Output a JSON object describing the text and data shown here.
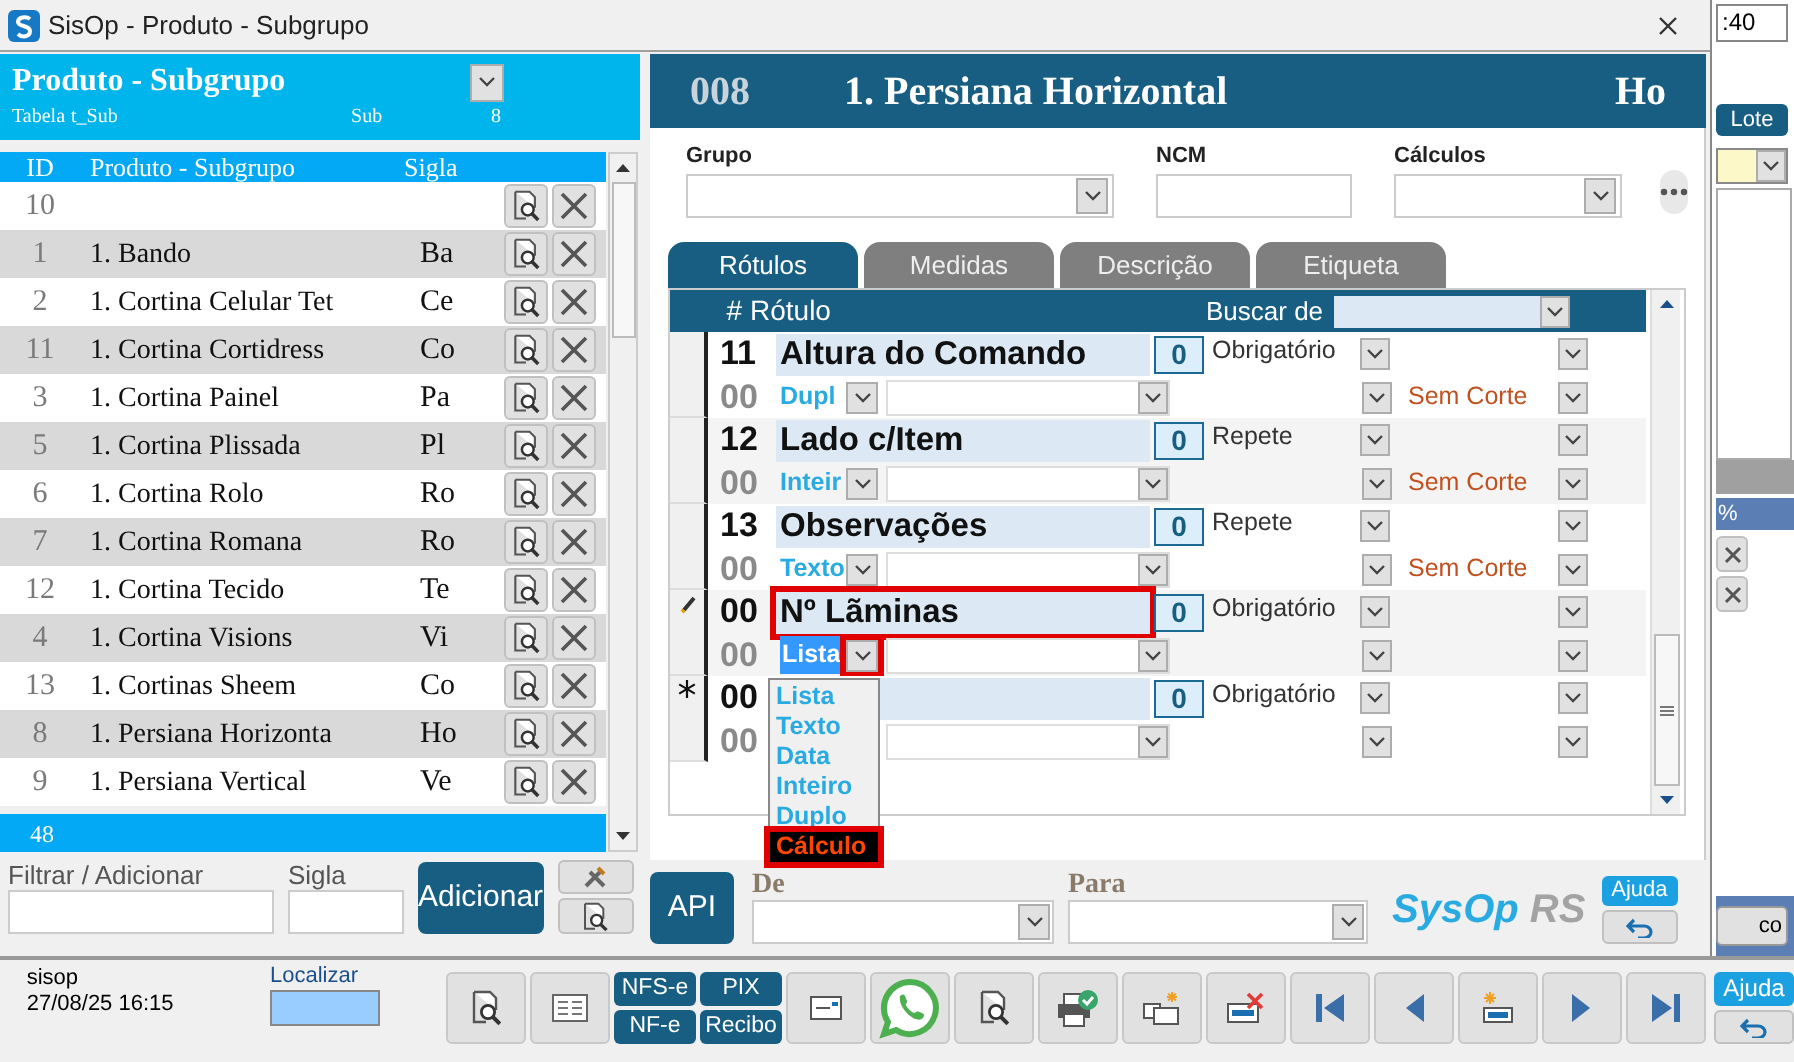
{
  "window": {
    "title": "SisOp - Produto - Subgrupo"
  },
  "list_panel": {
    "title": "Produto - Subgrupo",
    "table_label": "Tabela",
    "table_name": "t_Sub",
    "prefix": "Sub",
    "code": "8",
    "columns": [
      "ID",
      "Produto - Subgrupo",
      "Sigla"
    ],
    "rows": [
      {
        "id": "10",
        "name": "",
        "sigla": ""
      },
      {
        "id": "1",
        "name": "1. Bando",
        "sigla": "Ba"
      },
      {
        "id": "2",
        "name": "1. Cortina Celular Tet",
        "sigla": "Ce"
      },
      {
        "id": "11",
        "name": "1. Cortina Cortidress",
        "sigla": "Co"
      },
      {
        "id": "3",
        "name": "1. Cortina Painel",
        "sigla": "Pa"
      },
      {
        "id": "5",
        "name": "1. Cortina Plissada",
        "sigla": "Pl"
      },
      {
        "id": "6",
        "name": "1. Cortina Rolo",
        "sigla": "Ro"
      },
      {
        "id": "7",
        "name": "1. Cortina Romana",
        "sigla": "Ro"
      },
      {
        "id": "12",
        "name": "1. Cortina Tecido",
        "sigla": "Te"
      },
      {
        "id": "4",
        "name": "1. Cortina Visions",
        "sigla": "Vi"
      },
      {
        "id": "13",
        "name": "1. Cortinas Sheem",
        "sigla": "Co"
      },
      {
        "id": "8",
        "name": "1. Persiana Horizonta",
        "sigla": "Ho"
      },
      {
        "id": "9",
        "name": "1. Persiana Vertical",
        "sigla": "Ve"
      }
    ],
    "count": "48"
  },
  "filter": {
    "label": "Filtrar / Adicionar",
    "sigla_label": "Sigla",
    "add_button": "Adicionar"
  },
  "detail": {
    "code": "008",
    "title": "1. Persiana Horizontal",
    "sigla": "Ho",
    "fields": [
      {
        "label": "Grupo",
        "kind": "select"
      },
      {
        "label": "NCM",
        "kind": "text"
      },
      {
        "label": "Cálculos",
        "kind": "select"
      }
    ],
    "tabs": [
      {
        "label": "Rótulos",
        "selected": true
      },
      {
        "label": "Medidas",
        "selected": false
      },
      {
        "label": "Descrição",
        "selected": false
      },
      {
        "label": "Etiqueta",
        "selected": false
      }
    ],
    "grid": {
      "columns": [
        "#",
        "Rótulo"
      ],
      "search_label": "Buscar de",
      "records": [
        {
          "kind": "record",
          "number": "11",
          "label": "Altura do Comando",
          "count": "0",
          "rule": "Obrigatório",
          "sub_number": "00",
          "type": "Dupl",
          "cut": "Sem Corte",
          "label_highlighted": false,
          "type_selected": false,
          "type_dropdown_highlighted": false
        },
        {
          "kind": "record",
          "number": "12",
          "label": "Lado c/Item",
          "count": "0",
          "rule": "Repete",
          "sub_number": "00",
          "type": "Inteir",
          "cut": "Sem Corte",
          "label_highlighted": false,
          "type_selected": false,
          "type_dropdown_highlighted": false
        },
        {
          "kind": "record",
          "number": "13",
          "label": "Observações",
          "count": "0",
          "rule": "Repete",
          "sub_number": "00",
          "type": "Texto",
          "cut": "Sem Corte",
          "label_highlighted": false,
          "type_selected": false,
          "type_dropdown_highlighted": false
        },
        {
          "kind": "editing",
          "number": "00",
          "label": "Nº Lãminas",
          "count": "0",
          "rule": "Obrigatório",
          "sub_number": "00",
          "type": "Lista",
          "label_highlighted": true,
          "type_selected": true,
          "type_dropdown_highlighted": true
        },
        {
          "kind": "new",
          "number": "00",
          "count": "0",
          "rule": "Obrigatório",
          "sub_number": "00",
          "label_highlighted": false
        }
      ]
    },
    "type_menu": [
      {
        "label": "Lista",
        "selected": false,
        "highlighted": false
      },
      {
        "label": "Texto",
        "selected": false,
        "highlighted": false
      },
      {
        "label": "Data",
        "selected": false,
        "highlighted": false
      },
      {
        "label": "Inteiro",
        "selected": false,
        "highlighted": false
      },
      {
        "label": "Duplo",
        "selected": false,
        "highlighted": false
      },
      {
        "label": "Cálculo",
        "selected": true,
        "highlighted": true
      }
    ],
    "api_button": "API",
    "from_label": "De",
    "to_label": "Para",
    "logo": {
      "main": "SysOp",
      "suffix": "RS"
    },
    "help_button": "Ajuda"
  },
  "background_window": {
    "field_value": ":40",
    "lote_button": "Lote",
    "percent": "%",
    "button": "co"
  },
  "status_bar": {
    "user": "sisop",
    "datetime": "27/08/25 16:15",
    "search_label": "Localizar"
  },
  "toolbar": [
    {
      "kind": "icon"
    },
    {
      "kind": "icon"
    },
    {
      "kind": "pair",
      "labels": [
        "NFS-e",
        "NF-e"
      ]
    },
    {
      "kind": "pair",
      "labels": [
        "PIX",
        "Recibo"
      ]
    },
    {
      "kind": "icon"
    },
    {
      "kind": "icon"
    },
    {
      "kind": "icon"
    },
    {
      "kind": "icon"
    },
    {
      "kind": "icon"
    },
    {
      "kind": "icon"
    },
    {
      "kind": "icon"
    },
    {
      "kind": "icon"
    },
    {
      "kind": "icon"
    },
    {
      "kind": "icon"
    },
    {
      "kind": "icon"
    },
    {
      "kind": "help",
      "labels": [
        "Ajuda"
      ]
    }
  ]
}
